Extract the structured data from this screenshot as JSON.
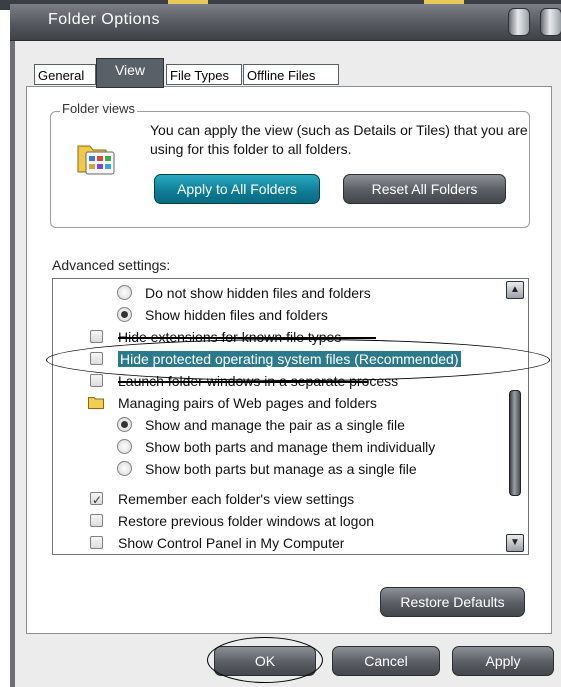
{
  "window": {
    "title": "Folder Options"
  },
  "tabs": [
    {
      "label": "General",
      "active": false
    },
    {
      "label": "View",
      "active": true
    },
    {
      "label": "File Types",
      "active": false
    },
    {
      "label": "Offline Files",
      "active": false
    }
  ],
  "folder_views": {
    "group_label": "Folder views",
    "description": "You can apply the view (such as Details or Tiles) that you are using for this folder to all folders.",
    "apply_button": "Apply to All Folders",
    "reset_button": "Reset All Folders"
  },
  "advanced": {
    "label": "Advanced settings:",
    "items": [
      {
        "type": "radio",
        "checked": false,
        "text": "Do not show hidden files and folders"
      },
      {
        "type": "radio",
        "checked": true,
        "text": "Show hidden files and folders"
      },
      {
        "type": "checkbox",
        "checked": false,
        "text": "Hide extensions for known file types"
      },
      {
        "type": "checkbox",
        "checked": false,
        "selected": true,
        "text": "Hide protected operating system files (Recommended)"
      },
      {
        "type": "checkbox",
        "checked": false,
        "text": "Launch folder windows in a separate process"
      },
      {
        "type": "folder",
        "text": "Managing pairs of Web pages and folders"
      },
      {
        "type": "radio",
        "checked": true,
        "text": "Show and manage the pair as a single file"
      },
      {
        "type": "radio",
        "checked": false,
        "text": "Show both parts and manage them individually"
      },
      {
        "type": "radio",
        "checked": false,
        "text": "Show both parts but manage as a single file"
      },
      {
        "type": "checkbox",
        "checked": true,
        "text": "Remember each folder's view settings"
      },
      {
        "type": "checkbox",
        "checked": false,
        "text": "Restore previous folder windows at logon"
      },
      {
        "type": "checkbox",
        "checked": false,
        "text": "Show Control Panel in My Computer"
      }
    ]
  },
  "buttons": {
    "restore_defaults": "Restore Defaults",
    "ok": "OK",
    "cancel": "Cancel",
    "apply": "Apply"
  },
  "colors": {
    "title_bar": "#55595f",
    "selection": "#2a7a8c",
    "apply_all_accent": "#0e7b94"
  }
}
